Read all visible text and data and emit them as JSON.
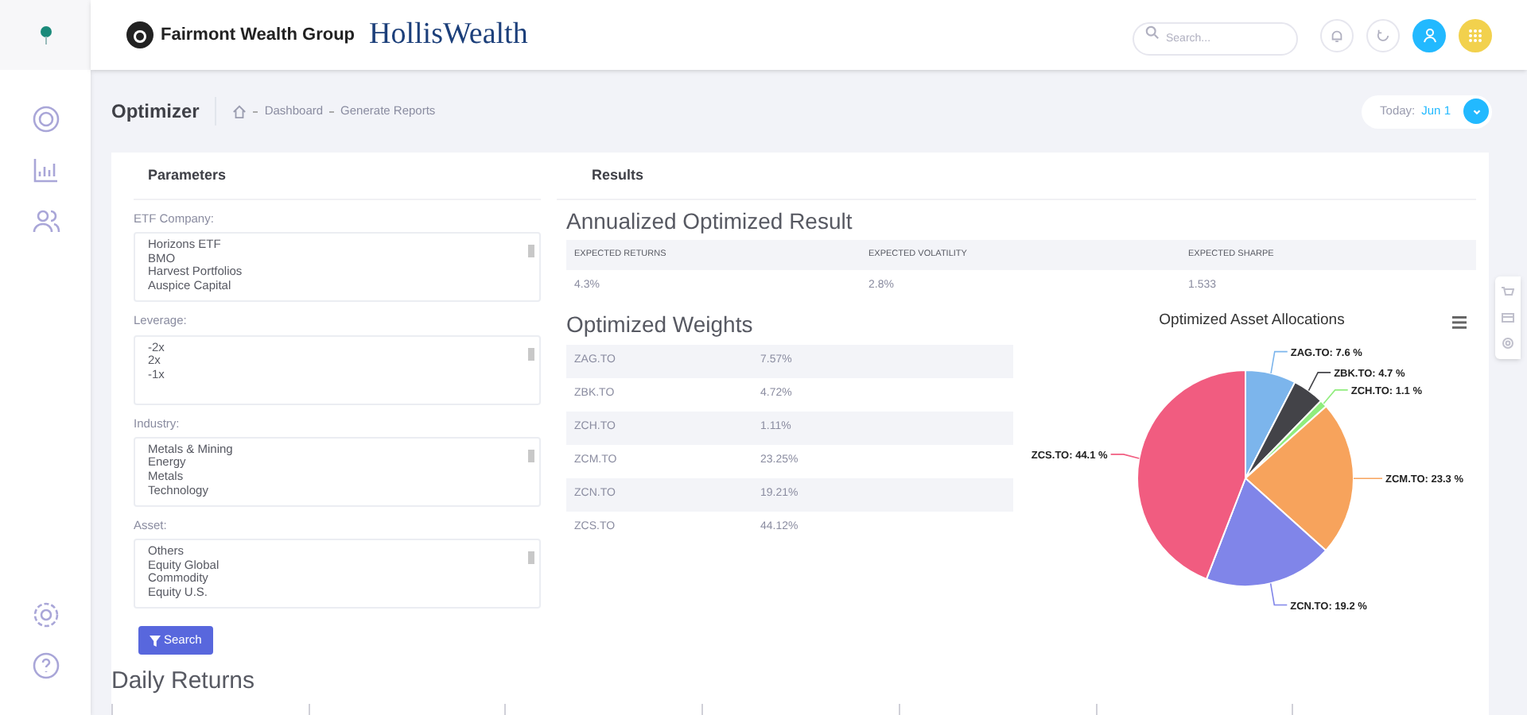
{
  "header": {
    "brand": "Fairmont Wealth Group",
    "partner_logo": "HollisWealth",
    "search": {
      "placeholder": "Search..."
    }
  },
  "page": {
    "title": "Optimizer",
    "breadcrumbs": [
      "Dashboard",
      "Generate Reports"
    ],
    "date_label": "Today:",
    "date_value": "Jun 1"
  },
  "parameters": {
    "title": "Parameters",
    "fields": [
      {
        "label": "ETF Company:",
        "options": [
          "Horizons ETF",
          "BMO",
          "Harvest Portfolios",
          "Auspice Capital"
        ]
      },
      {
        "label": "Leverage:",
        "options": [
          "-2x",
          "2x",
          "-1x"
        ]
      },
      {
        "label": "Industry:",
        "options": [
          "Metals & Mining",
          "Energy",
          "Metals",
          "Technology"
        ]
      },
      {
        "label": "Asset:",
        "options": [
          "Others",
          "Equity Global",
          "Commodity",
          "Equity U.S."
        ]
      }
    ],
    "search_button": "Search"
  },
  "results": {
    "title": "Results",
    "annualized": {
      "title": "Annualized Optimized Result",
      "columns": [
        "EXPECTED RETURNS",
        "EXPECTED VOLATILITY",
        "EXPECTED SHARPE"
      ],
      "values": [
        "4.3%",
        "2.8%",
        "1.533"
      ]
    },
    "weights": {
      "title": "Optimized Weights",
      "rows": [
        {
          "ticker": "ZAG.TO",
          "weight": "7.57%"
        },
        {
          "ticker": "ZBK.TO",
          "weight": "4.72%"
        },
        {
          "ticker": "ZCH.TO",
          "weight": "1.11%"
        },
        {
          "ticker": "ZCM.TO",
          "weight": "23.25%"
        },
        {
          "ticker": "ZCN.TO",
          "weight": "19.21%"
        },
        {
          "ticker": "ZCS.TO",
          "weight": "44.12%"
        }
      ]
    },
    "allocation": {
      "label_separator": ":",
      "chart_data": {
        "type": "pie",
        "title": "Optimized Asset Allocations",
        "categories": [
          "ZAG.TO",
          "ZBK.TO",
          "ZCH.TO",
          "ZCM.TO",
          "ZCN.TO",
          "ZCS.TO"
        ],
        "series": [
          {
            "values": [
              7.57,
              4.72,
              1.11,
              23.25,
              19.21,
              44.12
            ]
          }
        ],
        "value_labels": [
          "7.6 %",
          "4.7 %",
          "1.1 %",
          "23.3 %",
          "19.2 %",
          "44.1 %"
        ]
      }
    }
  },
  "daily_returns": {
    "title": "Daily Returns"
  }
}
